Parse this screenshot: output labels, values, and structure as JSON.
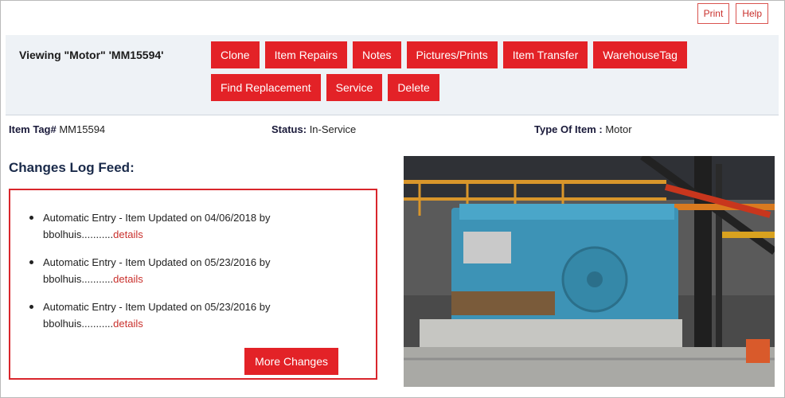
{
  "top_links": {
    "print": "Print",
    "help": "Help"
  },
  "header": {
    "title": "Viewing \"Motor\" 'MM15594'",
    "buttons_row1": [
      "Clone",
      "Item Repairs",
      "Notes",
      "Pictures/Prints",
      "Item Transfer",
      "WarehouseTag"
    ],
    "buttons_row2": [
      "Find Replacement",
      "Service",
      "Delete"
    ]
  },
  "info": {
    "tag_label": "Item Tag#",
    "tag_value": "MM15594",
    "status_label": "Status:",
    "status_value": "In-Service",
    "type_label": "Type Of Item :",
    "type_value": "Motor"
  },
  "log": {
    "title": "Changes Log Feed:",
    "entries": [
      {
        "text": "Automatic Entry - Item Updated on 04/06/2018 by bbolhuis...........",
        "link": "details"
      },
      {
        "text": "Automatic Entry - Item Updated on 05/23/2016 by bbolhuis...........",
        "link": "details"
      },
      {
        "text": "Automatic Entry - Item Updated on 05/23/2016 by bbolhuis...........",
        "link": "details"
      }
    ],
    "more_button": "More Changes"
  },
  "colors": {
    "accent": "#e32227",
    "header_bg": "#eef2f6",
    "link": "#c9302c"
  }
}
